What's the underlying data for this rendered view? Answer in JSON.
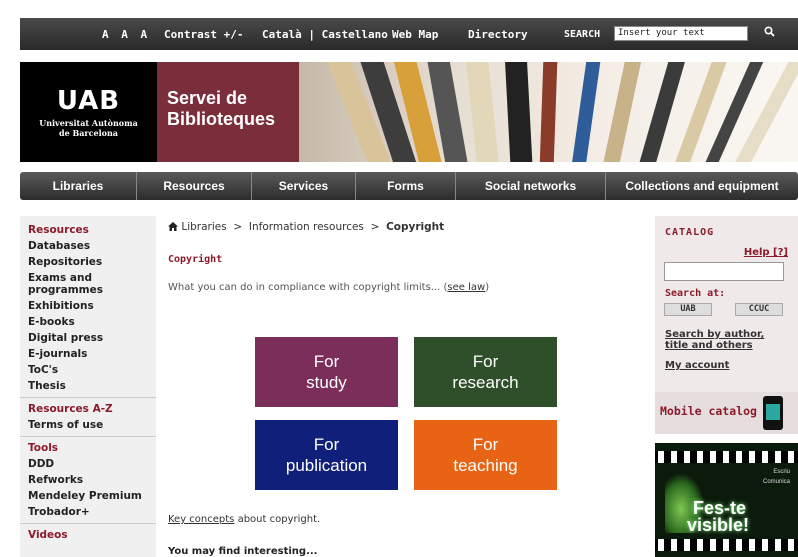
{
  "topbar": {
    "font_size_control": "A A A",
    "contrast": "Contrast +/-",
    "languages": "Català | Castellano",
    "web_map": "Web Map",
    "directory": "Directory",
    "search_label": "SEARCH",
    "search_value": "Insert your text"
  },
  "banner": {
    "logo_mark": "UAB",
    "logo_sub_1": "Universitat Autònoma",
    "logo_sub_2": "de Barcelona",
    "title_1": "Servei de",
    "title_2": "Biblioteques"
  },
  "nav": [
    "Libraries",
    "Resources",
    "Services",
    "Forms",
    "Social networks",
    "Collections and equipment"
  ],
  "sidebar": {
    "resources_head": "Resources",
    "resources": [
      "Databases",
      "Repositories",
      "Exams and",
      "programmes",
      "Exhibitions",
      "E-books",
      "Digital press",
      "E-journals",
      "ToC's",
      "Thesis"
    ],
    "az_head": "Resources A-Z",
    "terms": "Terms of use",
    "tools_head": "Tools",
    "tools": [
      "DDD",
      "Refworks",
      "Mendeley Premium",
      "Trobador+"
    ],
    "videos_head": "Videos"
  },
  "breadcrumb": {
    "home": "Libraries",
    "sep": ">",
    "mid": "Information resources",
    "current": "Copyright"
  },
  "page": {
    "title": "Copyright",
    "intro": "What you can do in compliance with copyright limits... (",
    "intro_link": "see law",
    "intro_end": ")",
    "key_link": "Key concepts",
    "key_rest": " about copyright.",
    "may_find": "You may find interesting..."
  },
  "tiles": [
    {
      "l1": "For",
      "l2": "study",
      "color": "#7b2e5a"
    },
    {
      "l1": "For",
      "l2": "research",
      "color": "#2f4f2a"
    },
    {
      "l1": "For",
      "l2": "publication",
      "color": "#0f1f7a"
    },
    {
      "l1": "For",
      "l2": "teaching",
      "color": "#e86414"
    }
  ],
  "catalog": {
    "title": "CATALOG",
    "help": "Help [?]",
    "search_at": "Search at:",
    "opt_uab": "UAB",
    "opt_ccuc": "CCUC",
    "link_author_1": "Search by author,",
    "link_author_2": "title and others",
    "my_account": "My account",
    "mobile": "Mobile catalog"
  },
  "promo": {
    "small_1": "Escriu",
    "small_2": "Comunica",
    "big_1": "Fes-te",
    "big_2": "visible!"
  },
  "colors": {
    "accent": "#8b1a2a",
    "banner_title_bg": "#7a2e3b"
  }
}
